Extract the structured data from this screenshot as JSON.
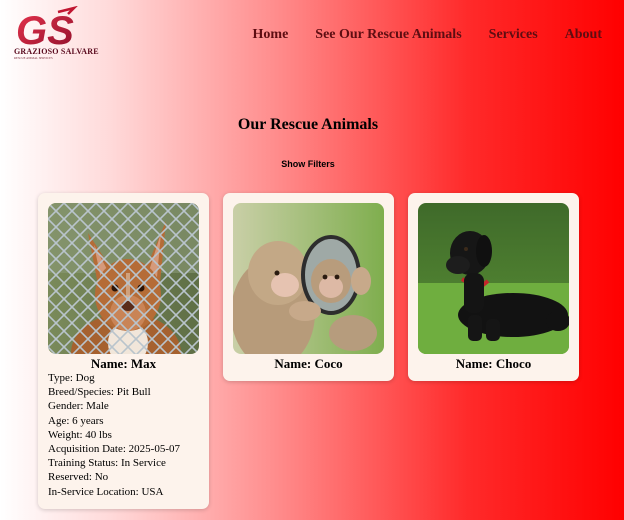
{
  "brand": {
    "logo_text": "GS",
    "name": "GRAZIOSO SALVARE",
    "tagline": "RESCUE ANIMAL SERVICES"
  },
  "nav": {
    "home": "Home",
    "animals": "See Our Rescue Animals",
    "services": "Services",
    "about": "About"
  },
  "page": {
    "title": "Our Rescue Animals",
    "show_filters": "Show Filters"
  },
  "animals": [
    {
      "name": "Name: Max",
      "photo": "dog-behind-fence-photo",
      "details": [
        "Type: Dog",
        "Breed/Species: Pit Bull",
        "Gender: Male",
        "Age: 6 years",
        "Weight: 40 lbs",
        "Acquisition Date: 2025-05-07",
        "Training Status: In Service",
        "Reserved: No",
        "In-Service Location: USA"
      ]
    },
    {
      "name": "Name: Coco",
      "photo": "monkeys-with-mirror-photo"
    },
    {
      "name": "Name: Choco",
      "photo": "black-labrador-photo"
    }
  ],
  "colors": {
    "nav_text": "#5e0d12",
    "card_bg": "#fdf3ec",
    "gradient_end": "#ff0000"
  }
}
